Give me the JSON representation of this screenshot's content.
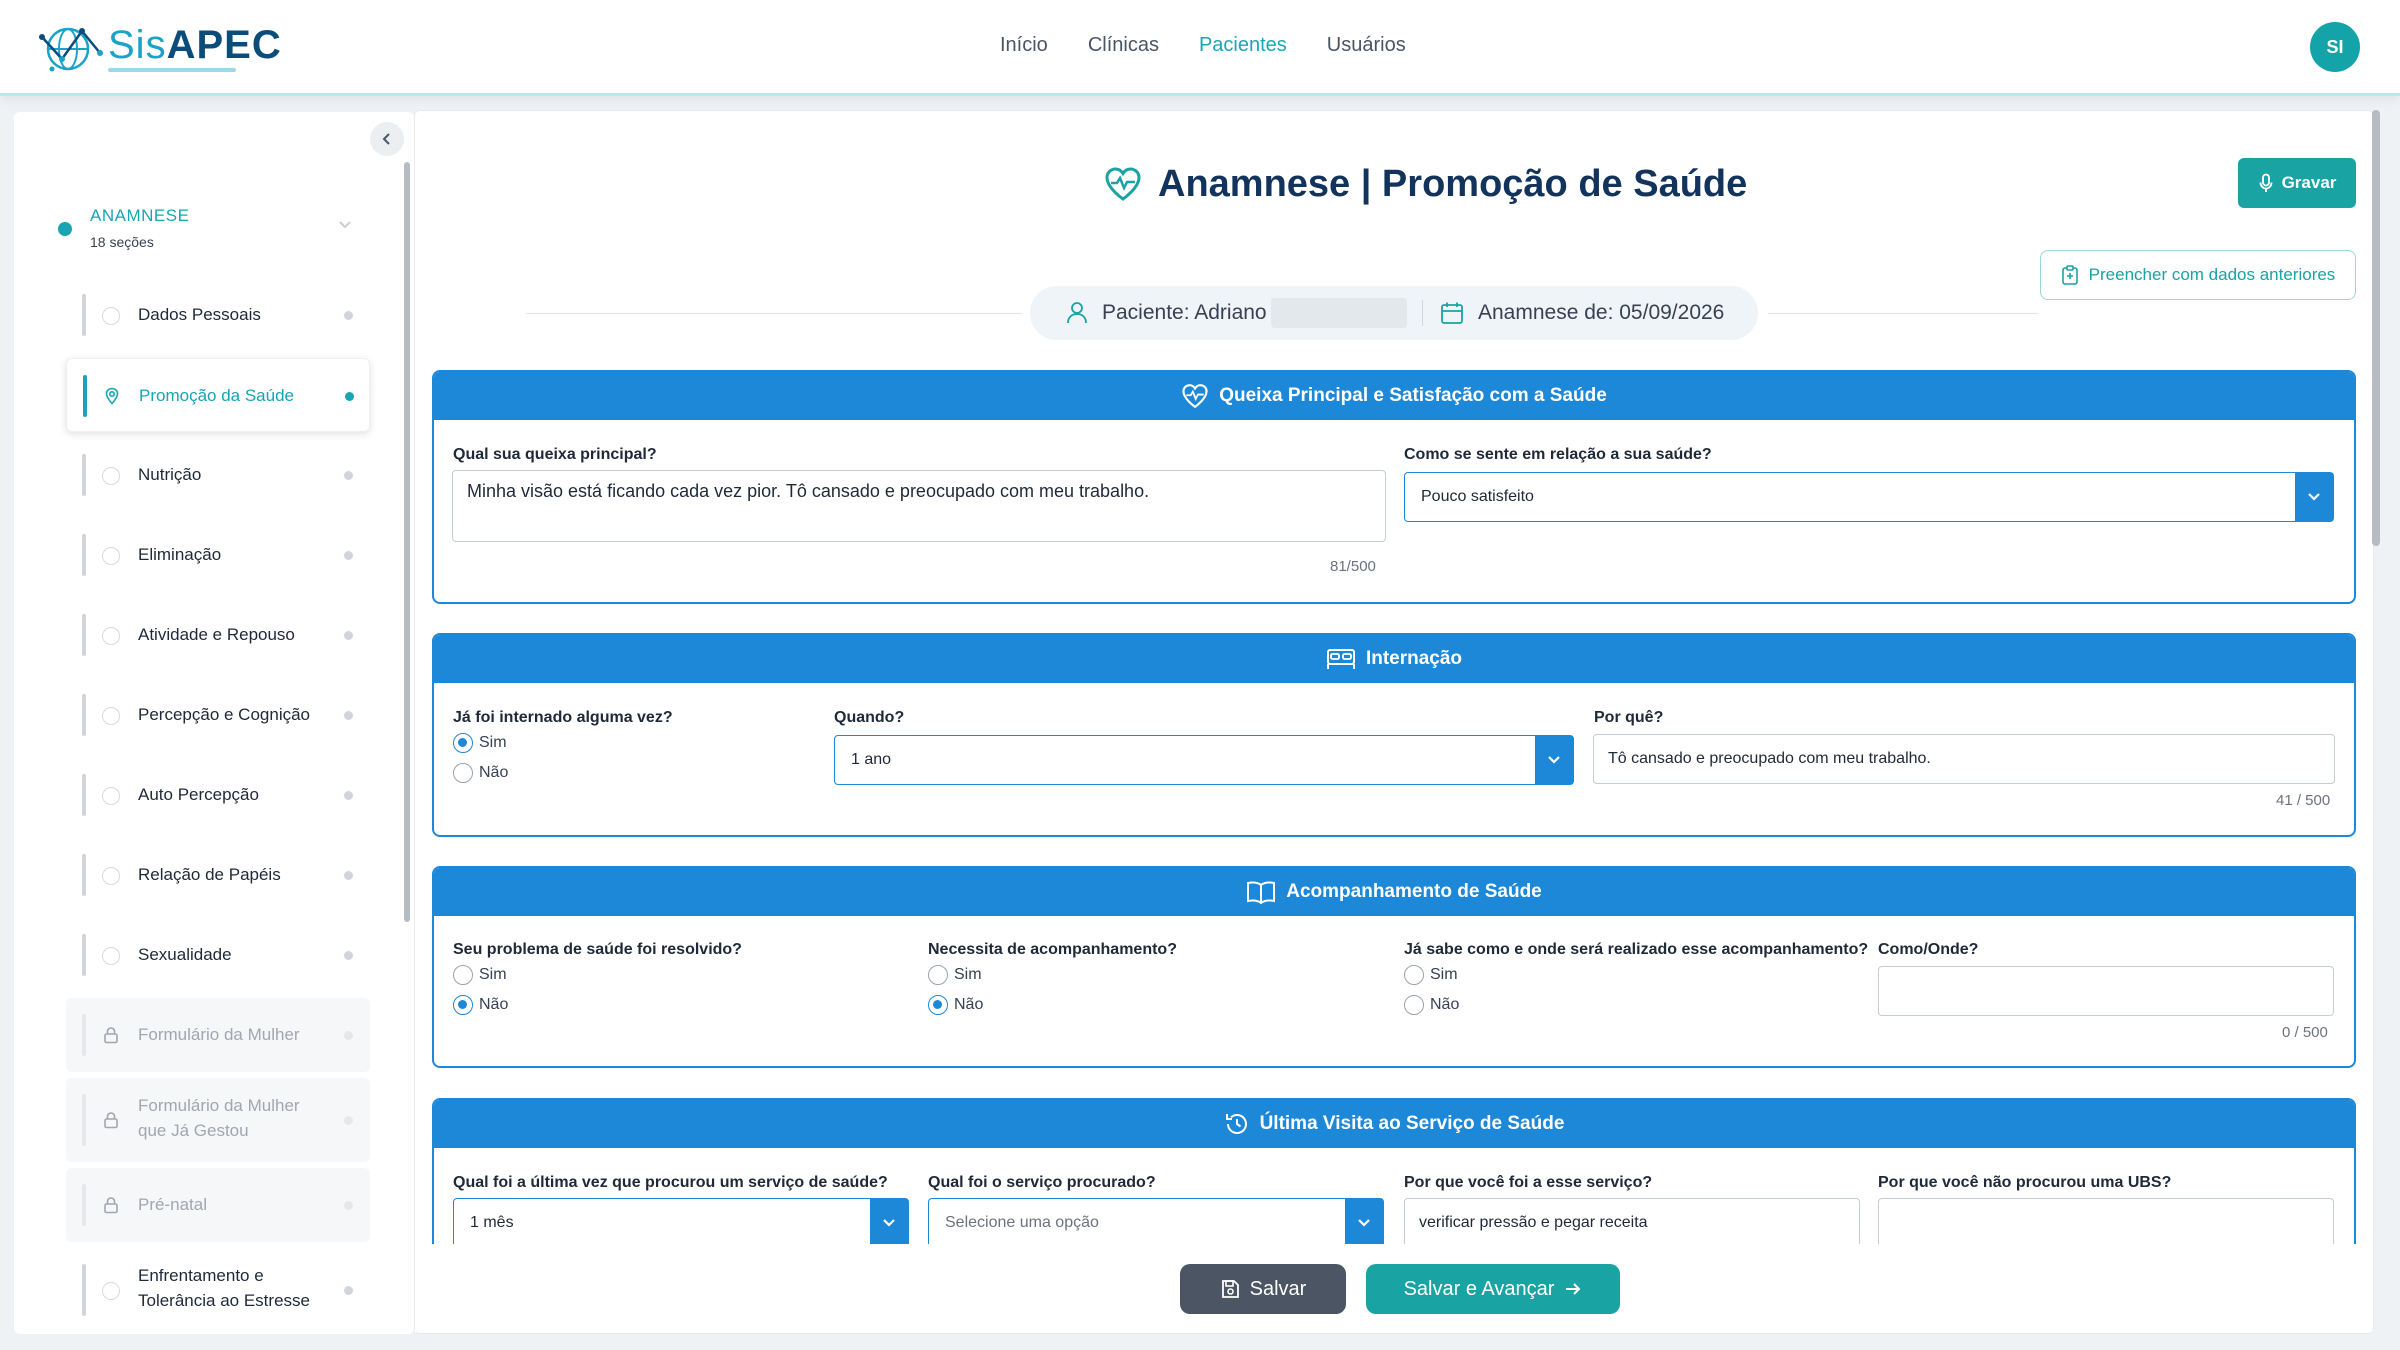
{
  "brand": {
    "name_prefix": "Sis",
    "name_main": "APEC"
  },
  "nav": {
    "items": [
      "Início",
      "Clínicas",
      "Pacientes",
      "Usuários"
    ],
    "active": "Pacientes"
  },
  "user": {
    "initials": "SI"
  },
  "sidebar": {
    "section_title": "ANAMNESE",
    "section_count": "18 seções",
    "items": [
      {
        "label": "Dados Pessoais",
        "state": "default"
      },
      {
        "label": "Promoção da Saúde",
        "state": "active"
      },
      {
        "label": "Nutrição",
        "state": "default"
      },
      {
        "label": "Eliminação",
        "state": "default"
      },
      {
        "label": "Atividade e Repouso",
        "state": "default"
      },
      {
        "label": "Percepção e Cognição",
        "state": "default"
      },
      {
        "label": "Auto Percepção",
        "state": "default"
      },
      {
        "label": "Relação de Papéis",
        "state": "default"
      },
      {
        "label": "Sexualidade",
        "state": "default"
      },
      {
        "label": "Formulário da Mulher",
        "state": "locked"
      },
      {
        "label_line1": "Formulário da Mulher",
        "label_line2": "que Já Gestou",
        "state": "locked"
      },
      {
        "label": "Pré-natal",
        "state": "locked"
      },
      {
        "label_line1": "Enfrentamento e",
        "label_line2": "Tolerância ao Estresse",
        "state": "default"
      }
    ]
  },
  "page": {
    "title": "Anamnese | Promoção de Saúde",
    "record_button": "Gravar",
    "prefill_button": "Preencher com dados anteriores",
    "patient_label": "Paciente: Adriano",
    "anamnese_date_label": "Anamnese de: 05/09/2026"
  },
  "queixa": {
    "header": "Queixa Principal e Satisfação com a Saúde",
    "q1_label": "Qual sua queixa principal?",
    "q1_value": "Minha visão está ficando cada vez pior. Tô cansado e preocupado com meu trabalho.",
    "q1_counter": "81/500",
    "q2_label": "Como se sente em relação a sua saúde?",
    "q2_value": "Pouco satisfeito"
  },
  "internacao": {
    "header": "Internação",
    "q1_label": "Já foi internado alguma vez?",
    "opt_yes": "Sim",
    "opt_no": "Não",
    "q1_selected": "Sim",
    "q2_label": "Quando?",
    "q2_value": "1 ano",
    "q3_label": "Por quê?",
    "q3_value": "Tô cansado e preocupado com meu trabalho.",
    "q3_counter": "41 / 500"
  },
  "acompanhamento": {
    "header": "Acompanhamento de Saúde",
    "q1_label": "Seu problema de saúde foi resolvido?",
    "q1_selected": "Não",
    "q2_label": "Necessita de acompanhamento?",
    "q2_selected": "Não",
    "q3_label": "Já sabe como e onde será realizado esse acompanhamento?",
    "q3_selected": "",
    "q4_label": "Como/Onde?",
    "q4_value": "",
    "q4_counter": "0 / 500",
    "opt_yes": "Sim",
    "opt_no": "Não"
  },
  "ultima_visita": {
    "header": "Última Visita ao Serviço de Saúde",
    "q1_label": "Qual foi a última vez que procurou um serviço de saúde?",
    "q1_value": "1 mês",
    "q2_label": "Qual foi o serviço procurado?",
    "q2_placeholder": "Selecione uma opção",
    "q3_label": "Por que você foi a esse serviço?",
    "q3_value": "verificar pressão e pegar receita",
    "q4_label": "Por que você não procurou uma UBS?",
    "q4_value": ""
  },
  "actions": {
    "save": "Salvar",
    "save_next": "Salvar e Avançar"
  },
  "colors": {
    "teal": "#1aa3a3",
    "blue_header": "#1e88d8",
    "navy_title": "#12345c"
  }
}
